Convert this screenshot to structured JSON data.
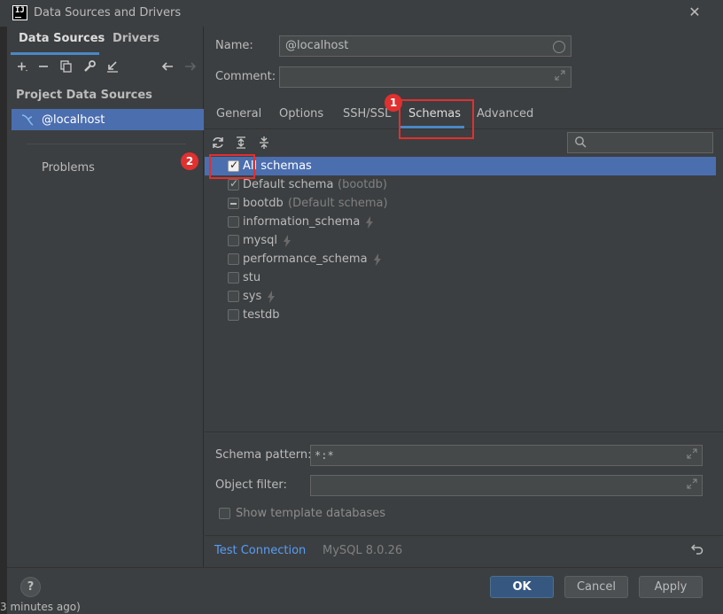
{
  "window": {
    "title": "Data Sources and Drivers",
    "app_icon": "IJ",
    "close_icon": "close-icon"
  },
  "left": {
    "tabs": [
      {
        "label": "Data Sources"
      },
      {
        "label": "Drivers"
      }
    ],
    "toolbar_icons": [
      "add-icon",
      "remove-icon",
      "duplicate-icon",
      "settings-wrench-icon",
      "import-icon",
      "back-arrow-icon",
      "forward-arrow-icon"
    ],
    "section_header": "Project Data Sources",
    "data_source": "@localhost",
    "problems": "Problems"
  },
  "form": {
    "name_label": "Name:",
    "name_value": "@localhost",
    "comment_label": "Comment:",
    "comment_value": ""
  },
  "tabs": [
    {
      "label": "General"
    },
    {
      "label": "Options"
    },
    {
      "label": "SSH/SSL"
    },
    {
      "label": "Schemas",
      "active": true
    },
    {
      "label": "Advanced"
    }
  ],
  "annotations": {
    "badge1": "1",
    "badge2": "2"
  },
  "schema_toolbar_icons": [
    "refresh-icon",
    "expand-all-icon",
    "collapse-all-icon"
  ],
  "search": {
    "placeholder": ""
  },
  "tree": [
    {
      "label": "All schemas",
      "sub": "",
      "state": "checked",
      "bolt": false,
      "selected": true,
      "indent": 0
    },
    {
      "label": "Default schema",
      "sub": "(bootdb)",
      "state": "checked",
      "bolt": false,
      "selected": false,
      "indent": 1
    },
    {
      "label": "bootdb",
      "sub": "(Default schema)",
      "state": "partial",
      "bolt": false,
      "selected": false,
      "indent": 1
    },
    {
      "label": "information_schema",
      "sub": "",
      "state": "unchecked",
      "bolt": true,
      "selected": false,
      "indent": 1
    },
    {
      "label": "mysql",
      "sub": "",
      "state": "unchecked",
      "bolt": true,
      "selected": false,
      "indent": 1
    },
    {
      "label": "performance_schema",
      "sub": "",
      "state": "unchecked",
      "bolt": true,
      "selected": false,
      "indent": 1
    },
    {
      "label": "stu",
      "sub": "",
      "state": "unchecked",
      "bolt": false,
      "selected": false,
      "indent": 1
    },
    {
      "label": "sys",
      "sub": "",
      "state": "unchecked",
      "bolt": true,
      "selected": false,
      "indent": 1
    },
    {
      "label": "testdb",
      "sub": "",
      "state": "unchecked",
      "bolt": false,
      "selected": false,
      "indent": 1
    }
  ],
  "bottom": {
    "schema_pattern_label": "Schema pattern:",
    "schema_pattern_value": "*:*",
    "object_filter_label": "Object filter:",
    "object_filter_value": "",
    "show_template_label": "Show template databases",
    "test_connection": "Test Connection",
    "mysql_version": "MySQL 8.0.26"
  },
  "buttons": {
    "help": "?",
    "ok": "OK",
    "cancel": "Cancel",
    "apply": "Apply"
  },
  "peek": "3 minutes ago)"
}
